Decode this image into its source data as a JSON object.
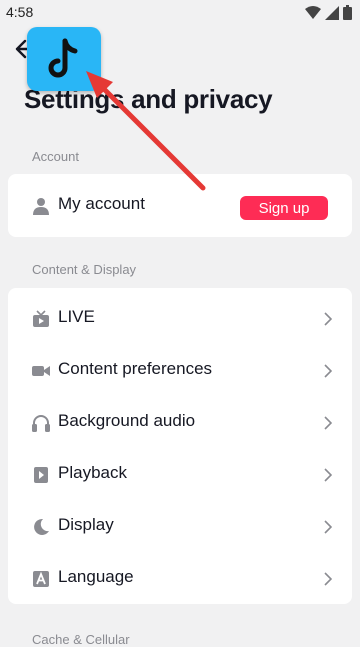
{
  "status_bar": {
    "time": "4:58"
  },
  "page": {
    "title": "Settings and privacy"
  },
  "sections": {
    "account": {
      "label": "Account",
      "items": [
        {
          "label": "My account",
          "icon": "person-icon"
        }
      ],
      "signup_label": "Sign up"
    },
    "content_display": {
      "label": "Content & Display",
      "items": [
        {
          "label": "LIVE",
          "icon": "tv-icon"
        },
        {
          "label": "Content preferences",
          "icon": "video-camera-icon"
        },
        {
          "label": "Background audio",
          "icon": "headphones-icon"
        },
        {
          "label": "Playback",
          "icon": "play-icon"
        },
        {
          "label": "Display",
          "icon": "moon-icon"
        },
        {
          "label": "Language",
          "icon": "language-a-icon"
        }
      ]
    },
    "next_section": {
      "label": "Cache & Cellular"
    }
  },
  "colors": {
    "background": "#f1f1f2",
    "card": "#ffffff",
    "accent": "#fe2c55",
    "app_icon_bg": "#29b6f6",
    "annotation_arrow": "#e53935"
  }
}
